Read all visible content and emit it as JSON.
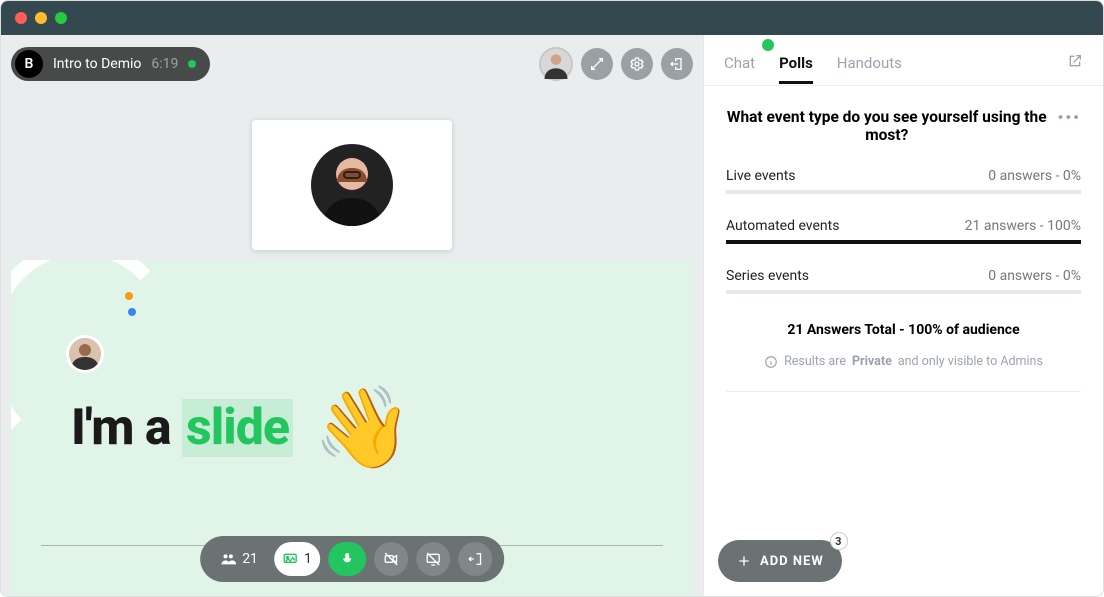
{
  "window": {
    "badge_letter": "B",
    "title": "Intro to Demio",
    "time": "6:19"
  },
  "slide": {
    "text_prefix": "I'm a ",
    "text_highlight": "slide"
  },
  "bottombar": {
    "people_count": "21",
    "slides_count": "1"
  },
  "tabs": {
    "chat": "Chat",
    "polls": "Polls",
    "handouts": "Handouts"
  },
  "poll": {
    "question": "What event type do you see yourself using the most?",
    "options": [
      {
        "label": "Live events",
        "result": "0 answers - 0%",
        "pct": 0
      },
      {
        "label": "Automated events",
        "result": "21 answers - 100%",
        "pct": 100
      },
      {
        "label": "Series events",
        "result": "0 answers - 0%",
        "pct": 0
      }
    ],
    "totals": "21 Answers Total - 100% of audience",
    "private_prefix": "Results are ",
    "private_bold": "Private",
    "private_suffix": " and only visible to Admins"
  },
  "addnew": {
    "label": "ADD NEW",
    "badge": "3"
  }
}
